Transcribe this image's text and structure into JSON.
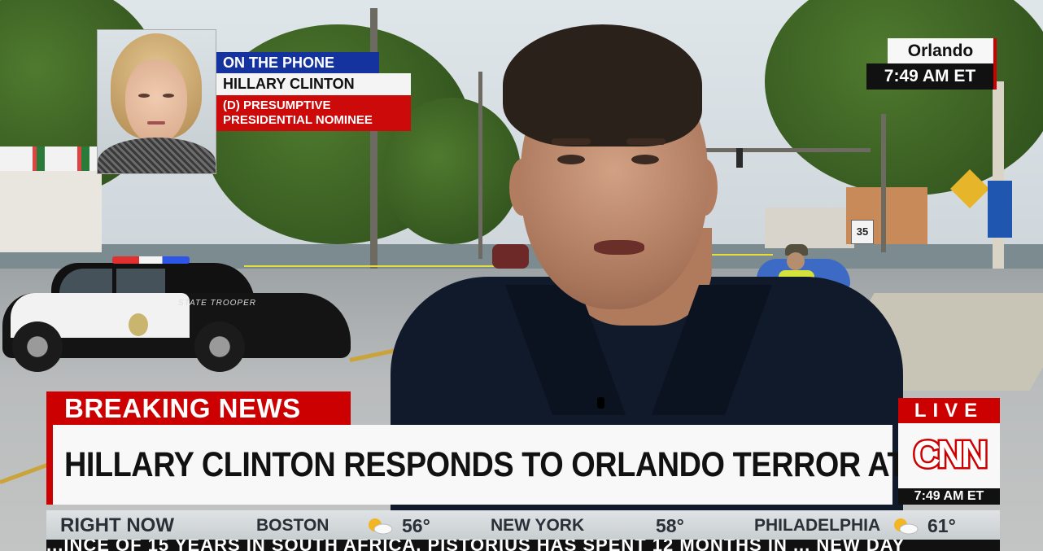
{
  "location_bug": {
    "city": "Orlando",
    "time": "7:49 AM ET"
  },
  "phone_inset": {
    "label": "ON THE PHONE",
    "name": "HILLARY CLINTON",
    "title_line1": "(D) PRESUMPTIVE",
    "title_line2": "PRESIDENTIAL NOMINEE"
  },
  "lower_third": {
    "breaking": "BREAKING NEWS",
    "headline": "HILLARY CLINTON RESPONDS TO ORLANDO TERROR ATTACK"
  },
  "network_bug": {
    "live": "LIVE",
    "logo": "CNN",
    "time": "7:49 AM ET"
  },
  "ticker": {
    "segment": "RIGHT NOW",
    "cities": [
      {
        "name": "BOSTON",
        "temp": "56°",
        "icon": "partly-cloudy-icon"
      },
      {
        "name": "NEW YORK",
        "temp": "58°",
        "icon": ""
      },
      {
        "name": "PHILADELPHIA",
        "temp": "61°",
        "icon": "partly-cloudy-icon"
      }
    ]
  },
  "crawl": {
    "text": "...INCE OF 15 YEARS IN SOUTH AFRICA, PISTORIUS HAS SPENT 12 MONTHS IN ... NEW DAY"
  },
  "scene": {
    "car_text": "STATE TROOPER",
    "speed_sign": "35"
  },
  "colors": {
    "cnn_red": "#cc0000",
    "inset_blue": "#14339f",
    "ticker_bg": "#d4d8db"
  }
}
